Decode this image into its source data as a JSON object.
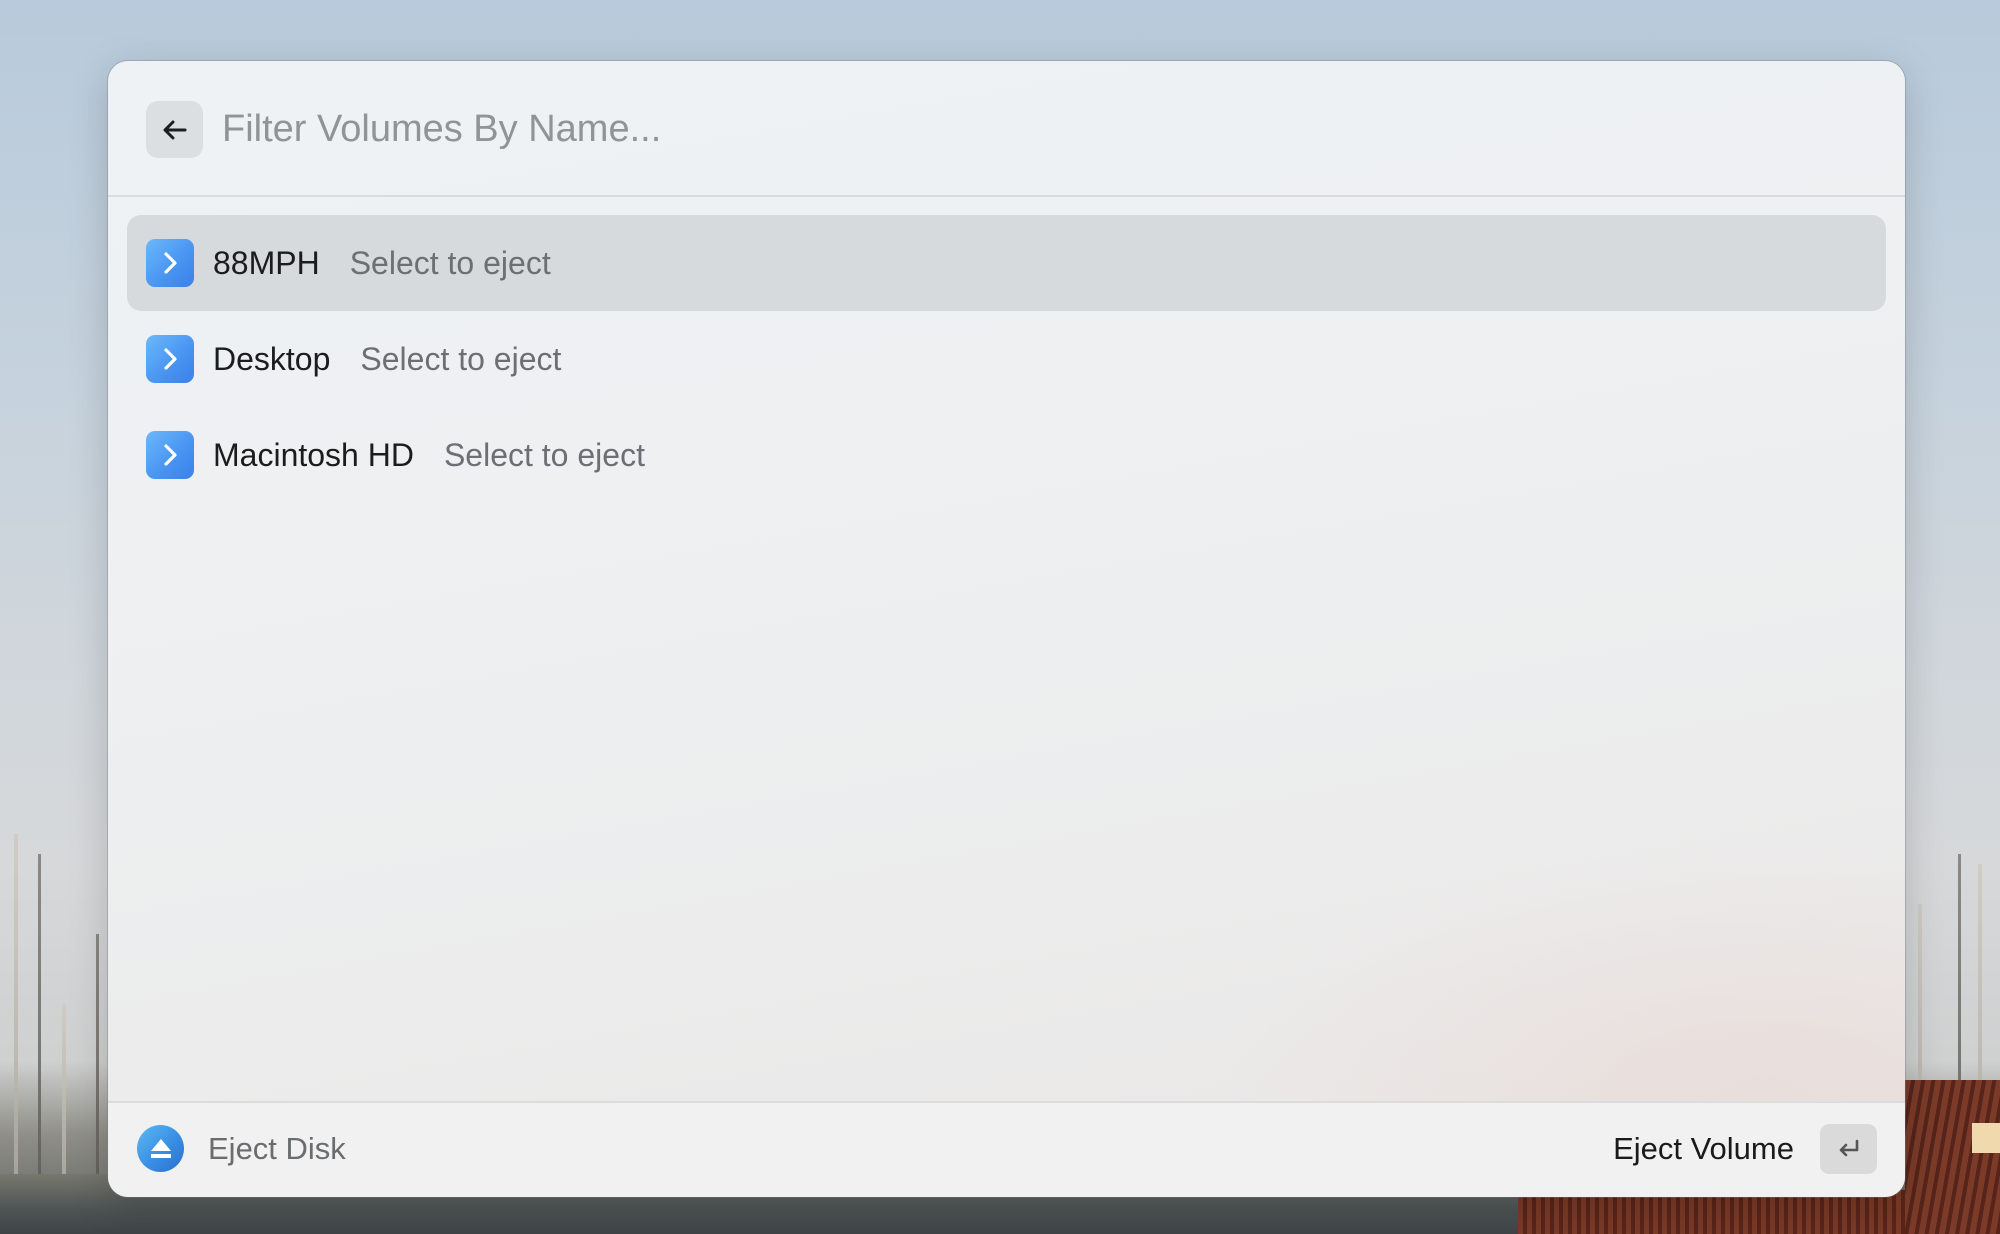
{
  "search": {
    "placeholder": "Filter Volumes By Name...",
    "value": ""
  },
  "header": {
    "back_icon": "arrow-left-icon"
  },
  "list": {
    "items": [
      {
        "title": "88MPH",
        "subtitle": "Select to eject",
        "icon": "chevron-right-icon",
        "selected": true
      },
      {
        "title": "Desktop",
        "subtitle": "Select to eject",
        "icon": "chevron-right-icon",
        "selected": false
      },
      {
        "title": "Macintosh HD",
        "subtitle": "Select to eject",
        "icon": "chevron-right-icon",
        "selected": false
      }
    ]
  },
  "footer": {
    "command_icon": "eject-icon",
    "command_title": "Eject Disk",
    "primary_action_label": "Eject Volume",
    "primary_action_shortcut_icon": "return-key-icon"
  },
  "colors": {
    "accent_blue": "#4a96f2",
    "selected_row_bg": "#d7dadd",
    "title_text": "#1b1c1d",
    "subtitle_text": "#6c6f73",
    "placeholder_text": "#8f9497"
  }
}
